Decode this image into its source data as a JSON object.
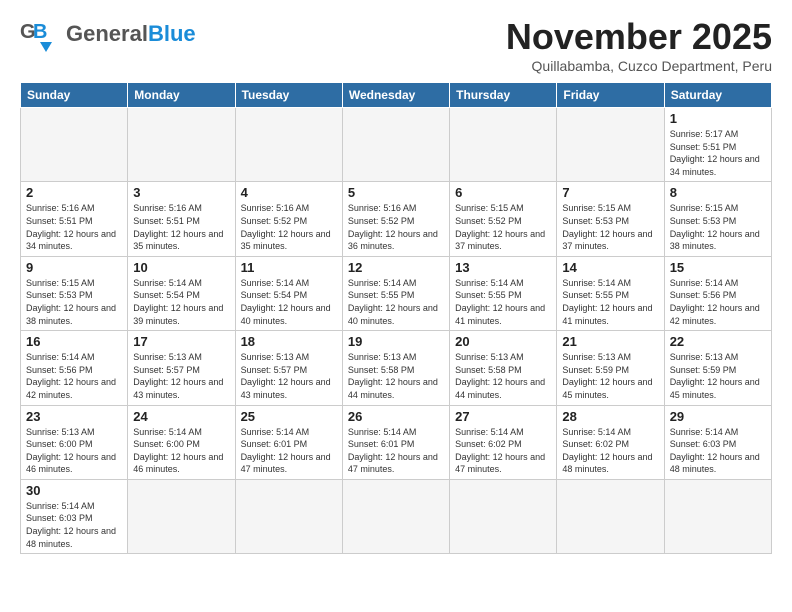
{
  "header": {
    "logo_general": "General",
    "logo_blue": "Blue",
    "month_title": "November 2025",
    "location": "Quillabamba, Cuzco Department, Peru"
  },
  "weekdays": [
    "Sunday",
    "Monday",
    "Tuesday",
    "Wednesday",
    "Thursday",
    "Friday",
    "Saturday"
  ],
  "days": [
    {
      "num": "",
      "sunrise": "",
      "sunset": "",
      "daylight": "",
      "empty": true
    },
    {
      "num": "",
      "sunrise": "",
      "sunset": "",
      "daylight": "",
      "empty": true
    },
    {
      "num": "",
      "sunrise": "",
      "sunset": "",
      "daylight": "",
      "empty": true
    },
    {
      "num": "",
      "sunrise": "",
      "sunset": "",
      "daylight": "",
      "empty": true
    },
    {
      "num": "",
      "sunrise": "",
      "sunset": "",
      "daylight": "",
      "empty": true
    },
    {
      "num": "",
      "sunrise": "",
      "sunset": "",
      "daylight": "",
      "empty": true
    },
    {
      "num": "1",
      "sunrise": "Sunrise: 5:17 AM",
      "sunset": "Sunset: 5:51 PM",
      "daylight": "Daylight: 12 hours and 34 minutes."
    },
    {
      "num": "2",
      "sunrise": "Sunrise: 5:16 AM",
      "sunset": "Sunset: 5:51 PM",
      "daylight": "Daylight: 12 hours and 34 minutes."
    },
    {
      "num": "3",
      "sunrise": "Sunrise: 5:16 AM",
      "sunset": "Sunset: 5:51 PM",
      "daylight": "Daylight: 12 hours and 35 minutes."
    },
    {
      "num": "4",
      "sunrise": "Sunrise: 5:16 AM",
      "sunset": "Sunset: 5:52 PM",
      "daylight": "Daylight: 12 hours and 35 minutes."
    },
    {
      "num": "5",
      "sunrise": "Sunrise: 5:16 AM",
      "sunset": "Sunset: 5:52 PM",
      "daylight": "Daylight: 12 hours and 36 minutes."
    },
    {
      "num": "6",
      "sunrise": "Sunrise: 5:15 AM",
      "sunset": "Sunset: 5:52 PM",
      "daylight": "Daylight: 12 hours and 37 minutes."
    },
    {
      "num": "7",
      "sunrise": "Sunrise: 5:15 AM",
      "sunset": "Sunset: 5:53 PM",
      "daylight": "Daylight: 12 hours and 37 minutes."
    },
    {
      "num": "8",
      "sunrise": "Sunrise: 5:15 AM",
      "sunset": "Sunset: 5:53 PM",
      "daylight": "Daylight: 12 hours and 38 minutes."
    },
    {
      "num": "9",
      "sunrise": "Sunrise: 5:15 AM",
      "sunset": "Sunset: 5:53 PM",
      "daylight": "Daylight: 12 hours and 38 minutes."
    },
    {
      "num": "10",
      "sunrise": "Sunrise: 5:14 AM",
      "sunset": "Sunset: 5:54 PM",
      "daylight": "Daylight: 12 hours and 39 minutes."
    },
    {
      "num": "11",
      "sunrise": "Sunrise: 5:14 AM",
      "sunset": "Sunset: 5:54 PM",
      "daylight": "Daylight: 12 hours and 40 minutes."
    },
    {
      "num": "12",
      "sunrise": "Sunrise: 5:14 AM",
      "sunset": "Sunset: 5:55 PM",
      "daylight": "Daylight: 12 hours and 40 minutes."
    },
    {
      "num": "13",
      "sunrise": "Sunrise: 5:14 AM",
      "sunset": "Sunset: 5:55 PM",
      "daylight": "Daylight: 12 hours and 41 minutes."
    },
    {
      "num": "14",
      "sunrise": "Sunrise: 5:14 AM",
      "sunset": "Sunset: 5:55 PM",
      "daylight": "Daylight: 12 hours and 41 minutes."
    },
    {
      "num": "15",
      "sunrise": "Sunrise: 5:14 AM",
      "sunset": "Sunset: 5:56 PM",
      "daylight": "Daylight: 12 hours and 42 minutes."
    },
    {
      "num": "16",
      "sunrise": "Sunrise: 5:14 AM",
      "sunset": "Sunset: 5:56 PM",
      "daylight": "Daylight: 12 hours and 42 minutes."
    },
    {
      "num": "17",
      "sunrise": "Sunrise: 5:13 AM",
      "sunset": "Sunset: 5:57 PM",
      "daylight": "Daylight: 12 hours and 43 minutes."
    },
    {
      "num": "18",
      "sunrise": "Sunrise: 5:13 AM",
      "sunset": "Sunset: 5:57 PM",
      "daylight": "Daylight: 12 hours and 43 minutes."
    },
    {
      "num": "19",
      "sunrise": "Sunrise: 5:13 AM",
      "sunset": "Sunset: 5:58 PM",
      "daylight": "Daylight: 12 hours and 44 minutes."
    },
    {
      "num": "20",
      "sunrise": "Sunrise: 5:13 AM",
      "sunset": "Sunset: 5:58 PM",
      "daylight": "Daylight: 12 hours and 44 minutes."
    },
    {
      "num": "21",
      "sunrise": "Sunrise: 5:13 AM",
      "sunset": "Sunset: 5:59 PM",
      "daylight": "Daylight: 12 hours and 45 minutes."
    },
    {
      "num": "22",
      "sunrise": "Sunrise: 5:13 AM",
      "sunset": "Sunset: 5:59 PM",
      "daylight": "Daylight: 12 hours and 45 minutes."
    },
    {
      "num": "23",
      "sunrise": "Sunrise: 5:13 AM",
      "sunset": "Sunset: 6:00 PM",
      "daylight": "Daylight: 12 hours and 46 minutes."
    },
    {
      "num": "24",
      "sunrise": "Sunrise: 5:14 AM",
      "sunset": "Sunset: 6:00 PM",
      "daylight": "Daylight: 12 hours and 46 minutes."
    },
    {
      "num": "25",
      "sunrise": "Sunrise: 5:14 AM",
      "sunset": "Sunset: 6:01 PM",
      "daylight": "Daylight: 12 hours and 47 minutes."
    },
    {
      "num": "26",
      "sunrise": "Sunrise: 5:14 AM",
      "sunset": "Sunset: 6:01 PM",
      "daylight": "Daylight: 12 hours and 47 minutes."
    },
    {
      "num": "27",
      "sunrise": "Sunrise: 5:14 AM",
      "sunset": "Sunset: 6:02 PM",
      "daylight": "Daylight: 12 hours and 47 minutes."
    },
    {
      "num": "28",
      "sunrise": "Sunrise: 5:14 AM",
      "sunset": "Sunset: 6:02 PM",
      "daylight": "Daylight: 12 hours and 48 minutes."
    },
    {
      "num": "29",
      "sunrise": "Sunrise: 5:14 AM",
      "sunset": "Sunset: 6:03 PM",
      "daylight": "Daylight: 12 hours and 48 minutes."
    },
    {
      "num": "30",
      "sunrise": "Sunrise: 5:14 AM",
      "sunset": "Sunset: 6:03 PM",
      "daylight": "Daylight: 12 hours and 48 minutes."
    }
  ]
}
